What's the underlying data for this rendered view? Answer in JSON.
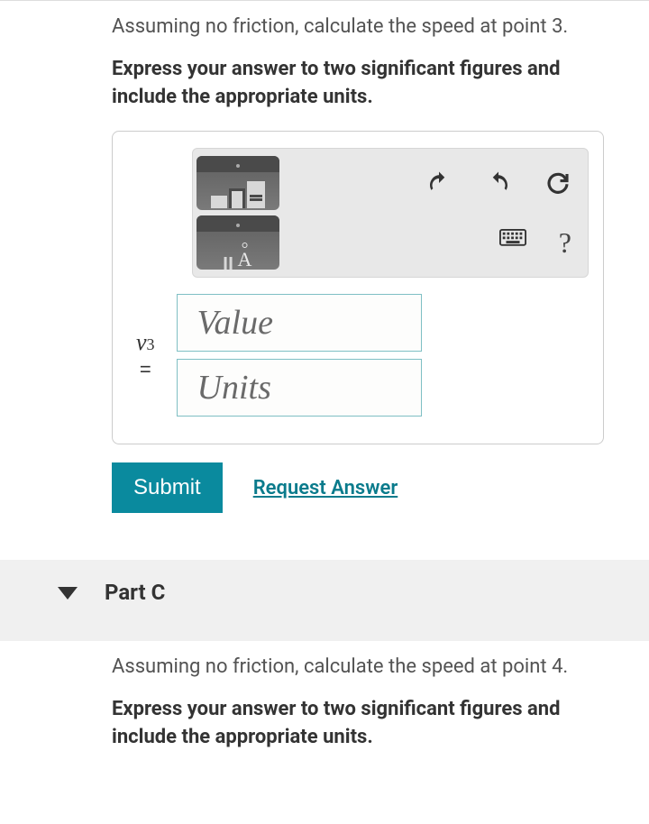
{
  "partB": {
    "prompt": "Assuming no friction, calculate the speed at point 3.",
    "instruction": "Express your answer to two significant figures and include the appropriate units.",
    "variable_html": "v",
    "variable_sub": "3",
    "equals": "=",
    "value_placeholder": "Value",
    "units_placeholder": "Units",
    "icons": {
      "templates": "templates-tool",
      "special": "special-characters-tool",
      "undo": "undo",
      "redo": "redo",
      "reset": "reset",
      "keyboard": "keyboard-shortcuts",
      "help": "?"
    }
  },
  "actions": {
    "submit": "Submit",
    "request": "Request Answer"
  },
  "partC": {
    "title": "Part C",
    "prompt": "Assuming no friction, calculate the speed at point 4.",
    "instruction": "Express your answer to two significant figures and include the appropriate units."
  }
}
